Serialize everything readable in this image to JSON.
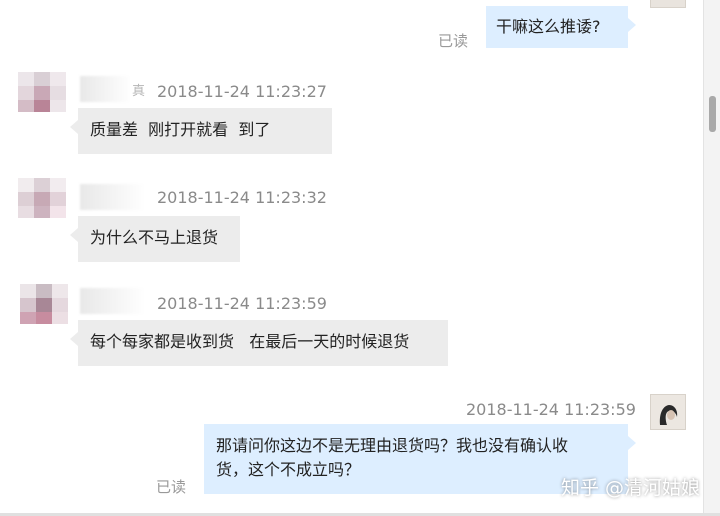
{
  "messages": [
    {
      "direction": "out",
      "text": "干嘛这么推诿?",
      "status": "已读"
    },
    {
      "direction": "in",
      "timestamp": "2018-11-24 11:23:27",
      "name_fragment": "真",
      "text": "质量差  刚打开就看  到了"
    },
    {
      "direction": "in",
      "timestamp": "2018-11-24 11:23:32",
      "text": "为什么不马上退货"
    },
    {
      "direction": "in",
      "timestamp": "2018-11-24 11:23:59",
      "text": "每个每家都是收到货   在最后一天的时候退货"
    },
    {
      "direction": "out",
      "timestamp": "2018-11-24 11:23:59",
      "text_line1": "那请问你这边不是无理由退货吗？我也没有确认收",
      "text_line2": "货，这个不成立吗？",
      "status": "已读"
    }
  ],
  "watermark": "知乎 @清河姑娘",
  "colors": {
    "incoming_bubble": "#ececec",
    "outgoing_bubble": "#ddeeff",
    "timestamp": "#8a8a8a"
  }
}
